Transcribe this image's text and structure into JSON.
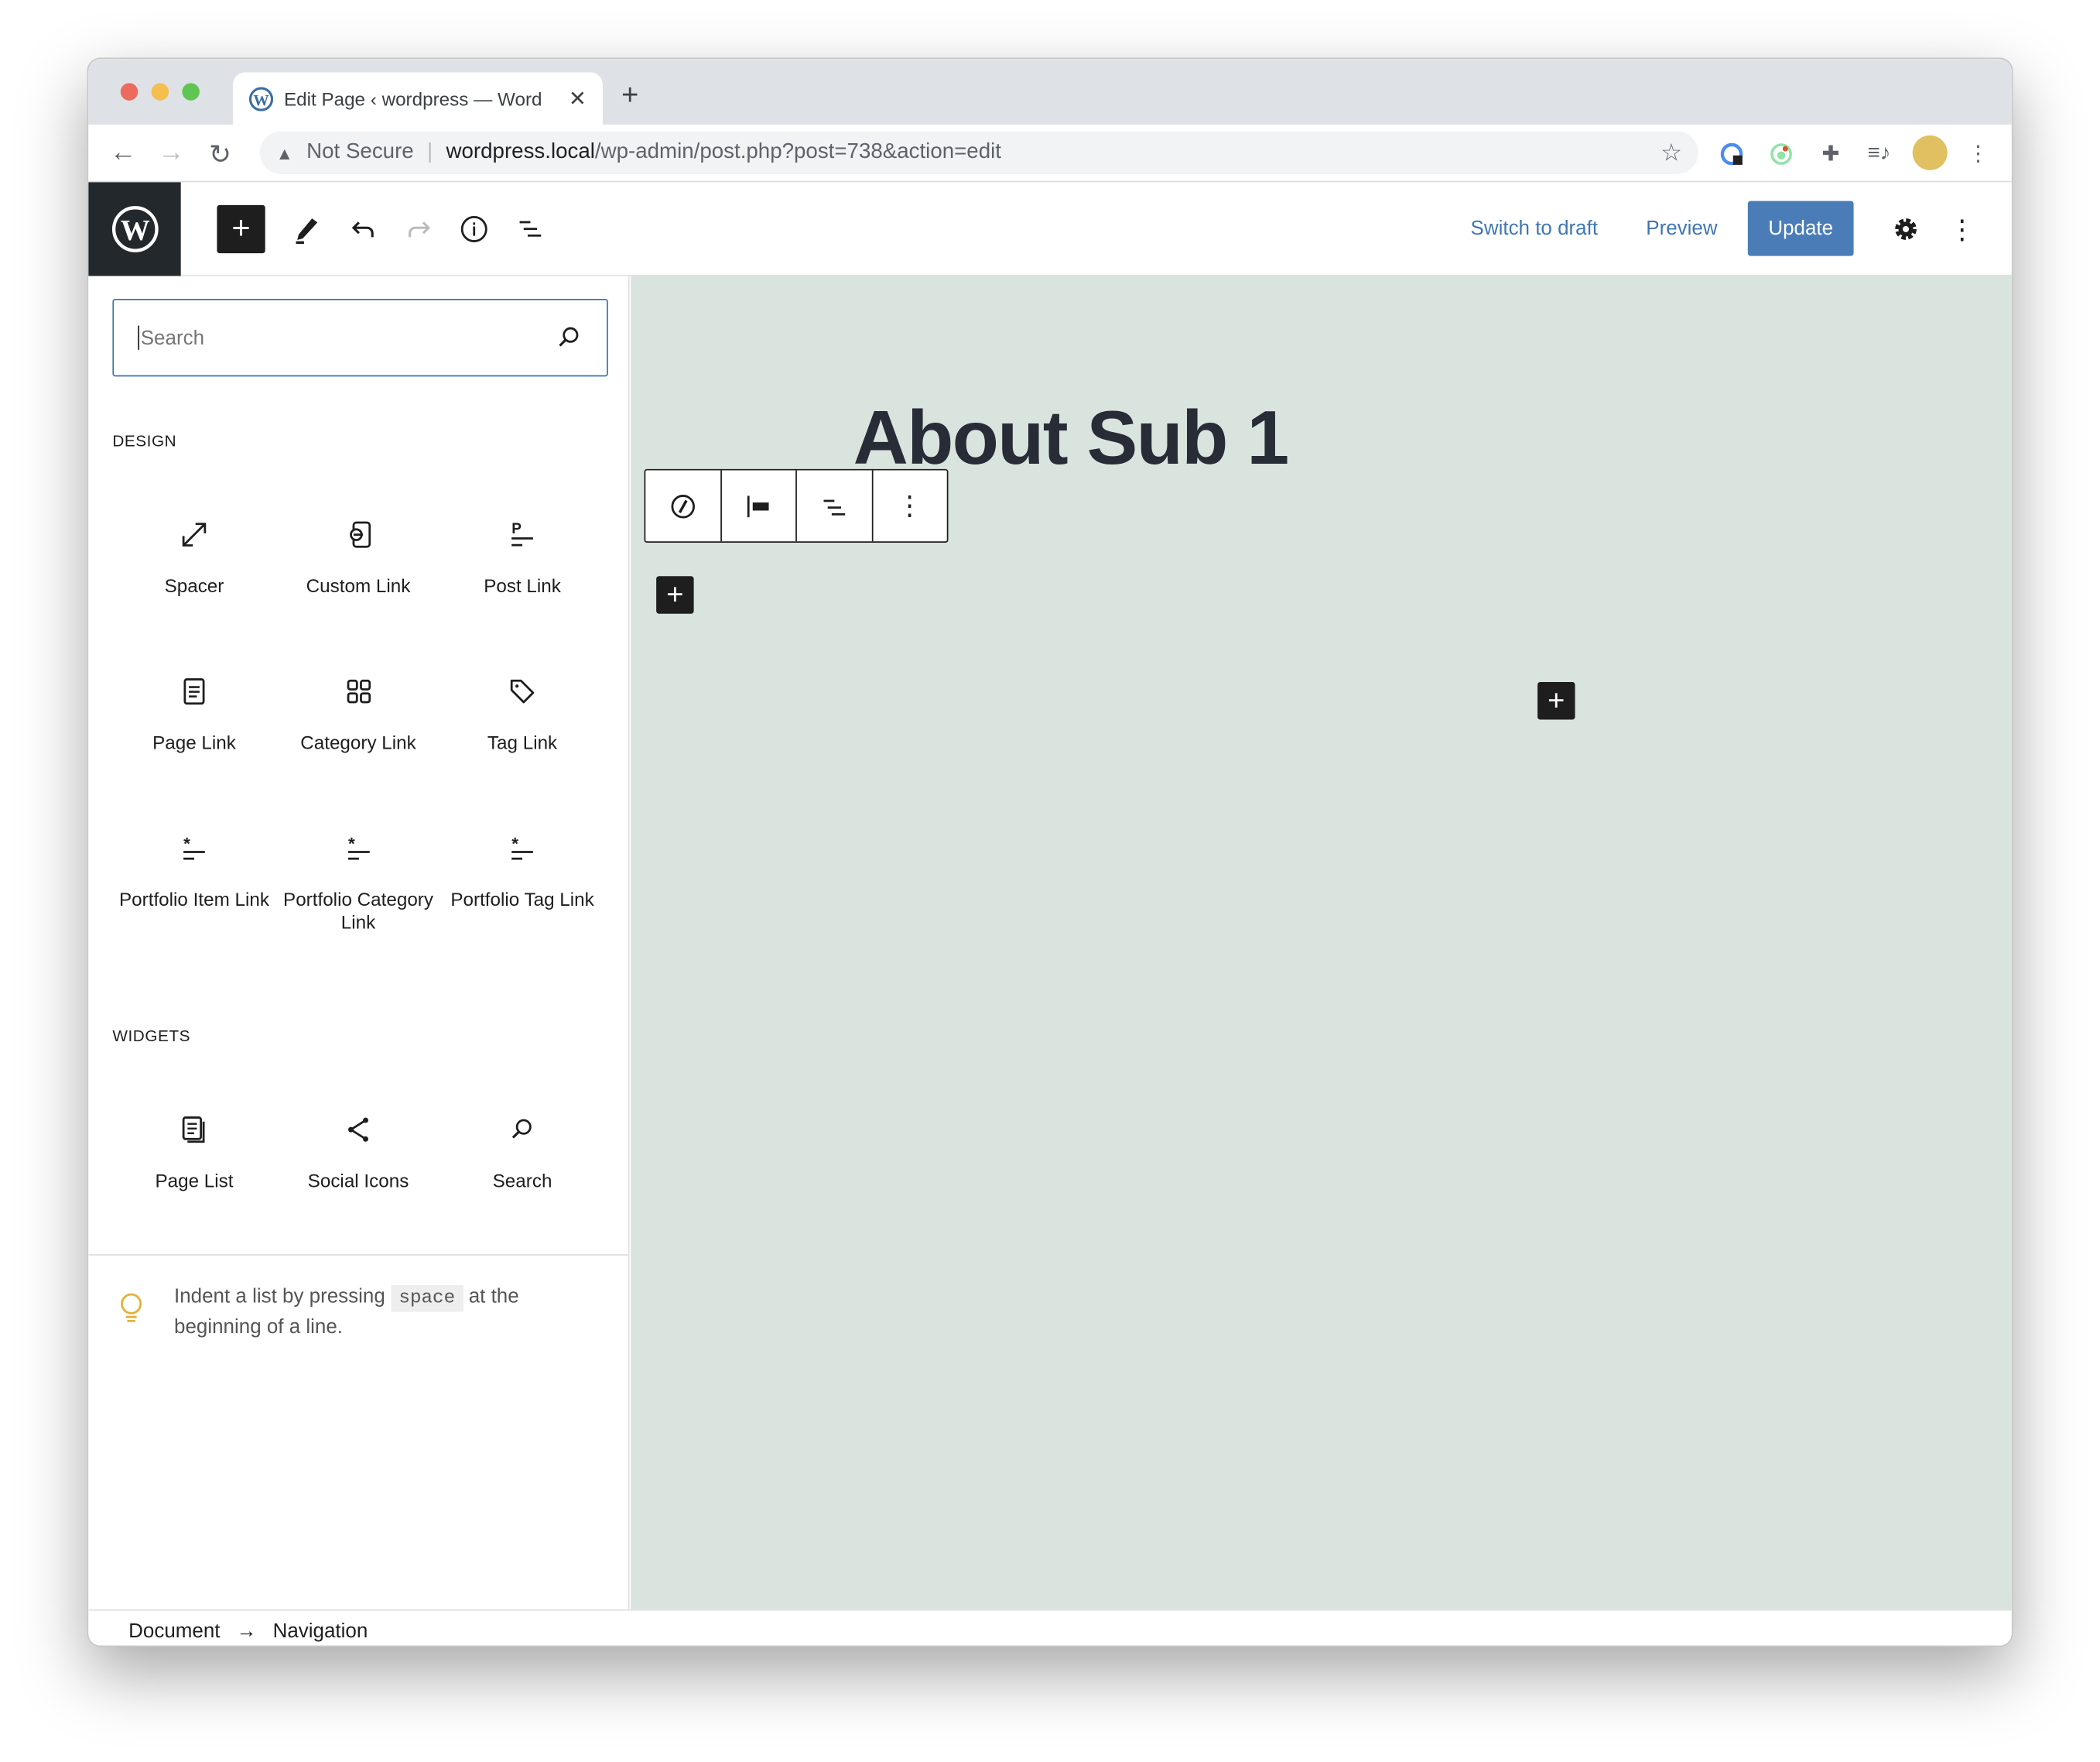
{
  "browser": {
    "tab_title": "Edit Page ‹ wordpress — WordPress",
    "tab_title_visible": "Edit Page ‹ wordpress — Word",
    "security": "Not Secure",
    "url_host": "wordpress.local",
    "url_path": "/wp-admin/post.php?post=738&action=edit"
  },
  "header": {
    "switch_to_draft": "Switch to draft",
    "preview": "Preview",
    "update": "Update",
    "accent": "#4a7db8"
  },
  "sidebar": {
    "search_placeholder": "Search",
    "design_label": "DESIGN",
    "design": [
      {
        "label": "Spacer",
        "icon": "resize-icon"
      },
      {
        "label": "Custom Link",
        "icon": "custom-link-icon"
      },
      {
        "label": "Post Link",
        "icon": "post-link-icon"
      },
      {
        "label": "Page Link",
        "icon": "page-icon"
      },
      {
        "label": "Category Link",
        "icon": "category-icon"
      },
      {
        "label": "Tag Link",
        "icon": "tag-icon"
      },
      {
        "label": "Portfolio Item Link",
        "icon": "custom-post-type-icon"
      },
      {
        "label": "Portfolio Category Link",
        "icon": "custom-post-type-icon"
      },
      {
        "label": "Portfolio Tag Link",
        "icon": "custom-post-type-icon"
      }
    ],
    "widgets_label": "WIDGETS",
    "widgets": [
      {
        "label": "Page List",
        "icon": "page-list-icon"
      },
      {
        "label": "Social Icons",
        "icon": "share-icon"
      },
      {
        "label": "Search",
        "icon": "search-icon"
      }
    ],
    "tip_before": "Indent a list by pressing ",
    "tip_key": "space",
    "tip_after": " at the beginning of a line."
  },
  "canvas": {
    "title": "About Sub 1",
    "background": "#d8e4dd"
  },
  "breadcrumb": {
    "items": [
      "Document",
      "Navigation"
    ]
  }
}
